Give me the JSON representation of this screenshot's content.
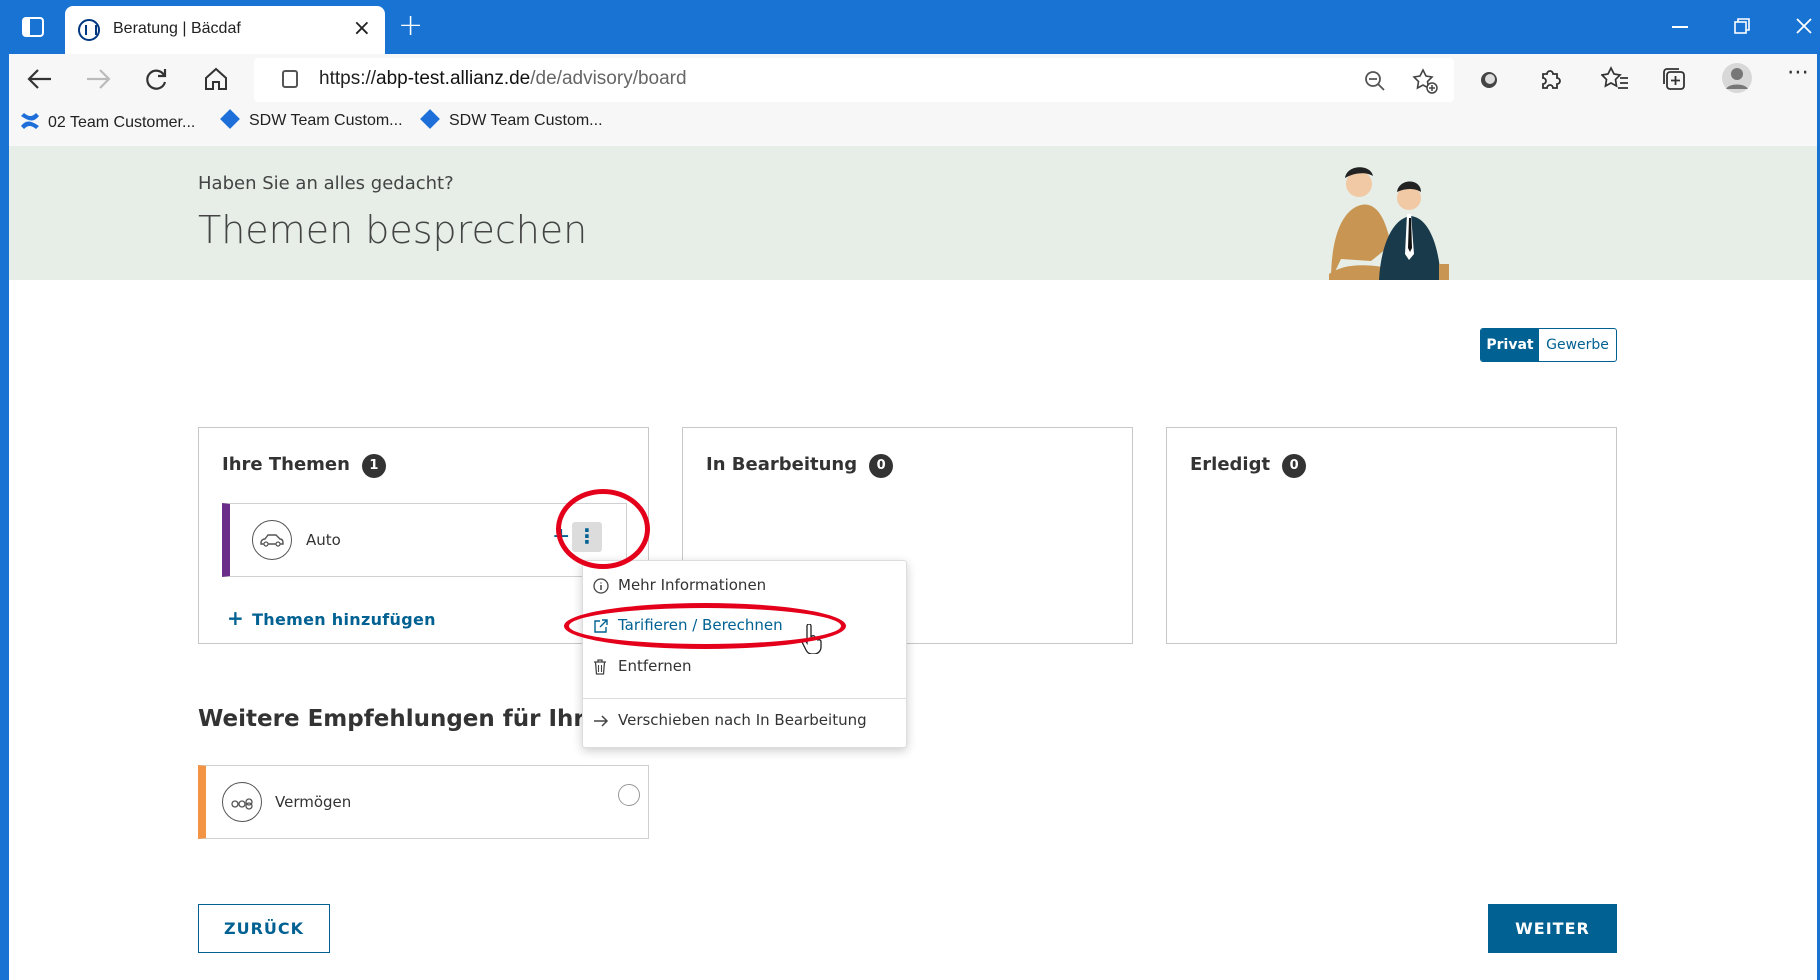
{
  "browser": {
    "tab_title": "Beratung | Bäcdaf",
    "tab_close": "×",
    "new_tab": "+",
    "url_prefix": "https://",
    "url_host": "abp-test.allianz.de",
    "url_path": "/de/advisory/board",
    "bookmarks": [
      {
        "label": "02 Team Customer..."
      },
      {
        "label": "SDW Team Custom..."
      },
      {
        "label": "SDW Team Custom..."
      }
    ]
  },
  "hero": {
    "pretitle": "Haben Sie an alles gedacht?",
    "title": "Themen besprechen"
  },
  "segment": {
    "selected": "Privat",
    "other": "Gewerbe"
  },
  "columns": [
    {
      "title": "Ihre Themen",
      "count": "1"
    },
    {
      "title": "In Bearbeitung",
      "count": "0"
    },
    {
      "title": "Erledigt",
      "count": "0"
    }
  ],
  "topic_card": {
    "label": "Auto",
    "accent": "#6b2d8a"
  },
  "add_topics": "Themen hinzufügen",
  "recommendations": {
    "heading": "Weitere Empfehlungen für Ihre opti",
    "card_label": "Vermögen",
    "accent": "#f39445"
  },
  "context_menu": {
    "items": [
      {
        "label": "Mehr Informationen",
        "icon": "info-icon"
      },
      {
        "label": "Tarifieren / Berechnen",
        "icon": "external-link-icon"
      },
      {
        "label": "Entfernen",
        "icon": "trash-icon"
      },
      {
        "label": "Verschieben nach In Bearbeitung",
        "icon": "arrow-right-icon"
      }
    ]
  },
  "buttons": {
    "back": "ZURÜCK",
    "next": "WEITER"
  },
  "colors": {
    "titlebar": "#1873d3",
    "primary": "#006192",
    "hero_bg": "#e6eee7",
    "annotation": "#e4001b"
  }
}
